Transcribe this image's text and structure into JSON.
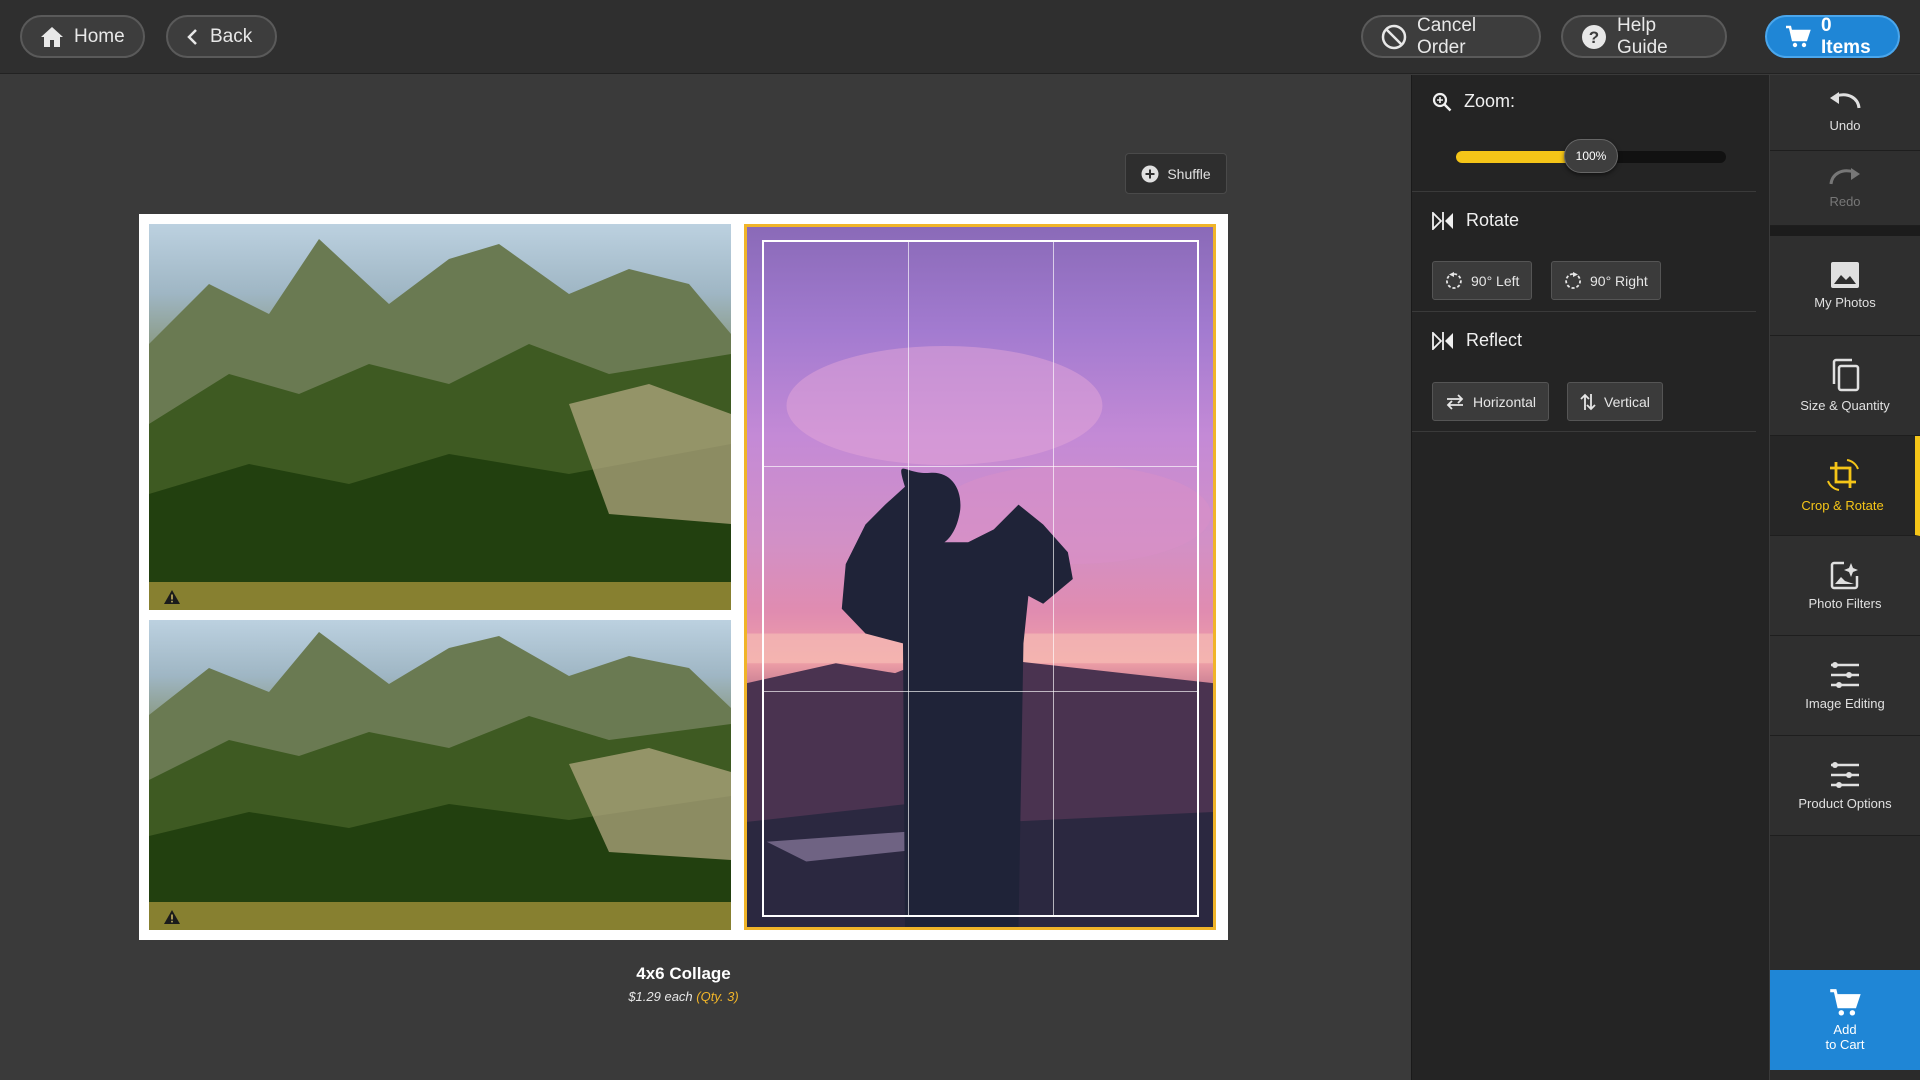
{
  "topbar": {
    "home_label": "Home",
    "back_label": "Back",
    "cancel_label": "Cancel Order",
    "help_label": "Help Guide",
    "cart_label": "0 Items"
  },
  "canvas": {
    "shuffle_label": "Shuffle",
    "product_title": "4x6 Collage",
    "price_text": "$1.29 each",
    "qty_text": "(Qty. 3)"
  },
  "tools": {
    "zoom_label": "Zoom:",
    "zoom_value": "100%",
    "zoom_fraction": 0.5,
    "rotate_label": "Rotate",
    "rotate_left_label": "90° Left",
    "rotate_right_label": "90° Right",
    "reflect_label": "Reflect",
    "horizontal_label": "Horizontal",
    "vertical_label": "Vertical"
  },
  "rail": {
    "undo_label": "Undo",
    "redo_label": "Redo",
    "my_photos_label": "My Photos",
    "size_quantity_label": "Size & Quantity",
    "crop_rotate_label": "Crop & Rotate",
    "photo_filters_label": "Photo Filters",
    "image_editing_label": "Image Editing",
    "product_options_label": "Product Options",
    "add_label": "Add",
    "to_cart_label": "to Cart"
  },
  "colors": {
    "accent": "#f5c518",
    "primary_blue": "#1f86d6",
    "selection_border": "#f0b429"
  }
}
